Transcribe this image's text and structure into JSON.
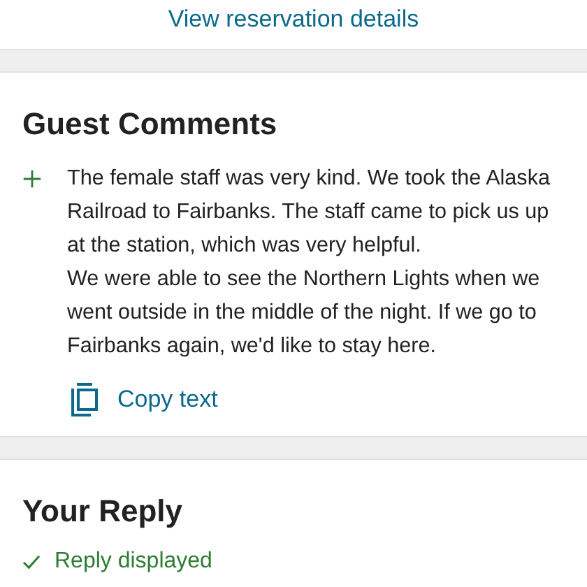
{
  "reservation_link": "View reservation details",
  "guest_comments": {
    "title": "Guest Comments",
    "paragraphs": [
      "The female staff was very kind. We took the Alaska Railroad to Fairbanks. The staff came to pick us up at the station, which was very helpful.",
      "We were able to see the Northern Lights when we went outside in the middle of the night. If we go to Fairbanks again, we'd like to stay here."
    ],
    "copy_button": "Copy text"
  },
  "your_reply": {
    "title": "Your Reply",
    "displayed": true,
    "status": "Reply displayed"
  }
}
